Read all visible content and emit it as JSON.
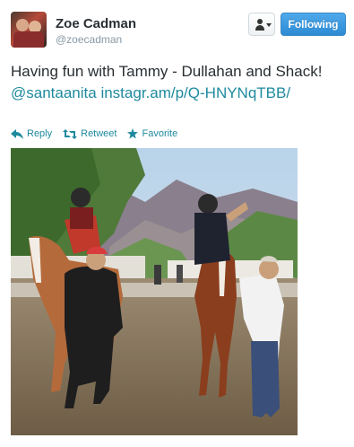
{
  "user": {
    "name": "Zoe Cadman",
    "handle": "@zoecadman"
  },
  "buttons": {
    "follow_label": "Following"
  },
  "tweet": {
    "text_prefix": "Having fun with Tammy - Dullahan and Shack!",
    "mention": "@santaanita",
    "link": "instagr.am/p/Q-HNYNqTBB/"
  },
  "actions": {
    "reply": "Reply",
    "retweet": "Retweet",
    "favorite": "Favorite"
  },
  "colors": {
    "link": "#1f8a9e",
    "follow_button": "#2d8bd4"
  },
  "icons": {
    "user": "user-icon",
    "reply": "reply-icon",
    "retweet": "retweet-icon",
    "favorite": "star-icon"
  }
}
